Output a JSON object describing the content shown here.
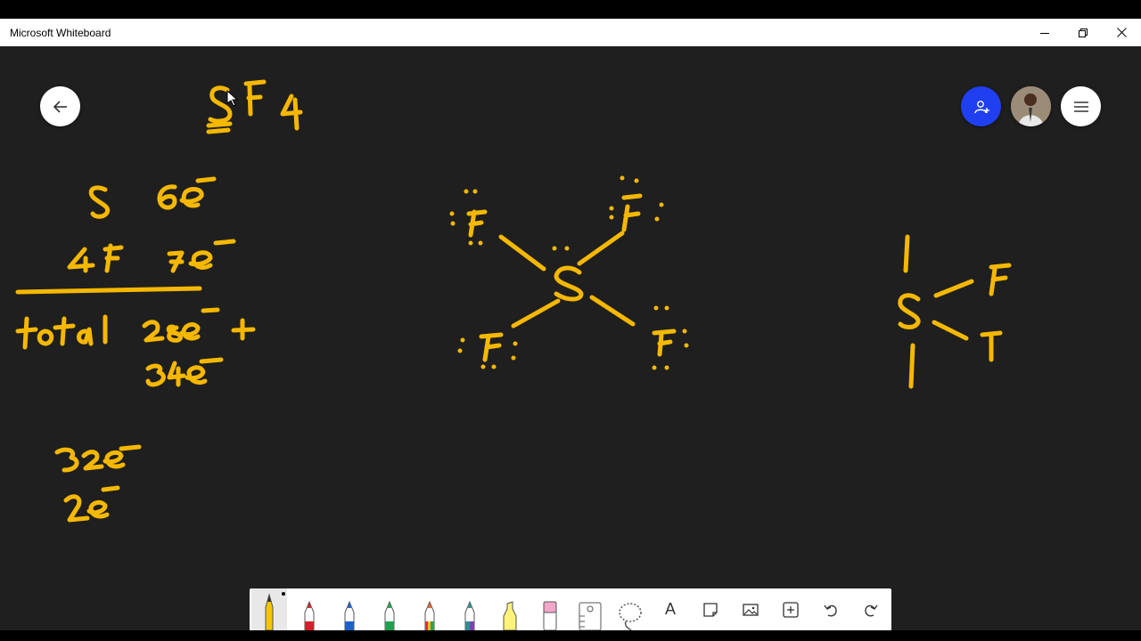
{
  "window": {
    "title": "Microsoft Whiteboard",
    "controls": [
      "minimize",
      "restore",
      "close"
    ]
  },
  "board": {
    "ink_color": "#f5b800",
    "background": "#1f1f1f",
    "handwriting": {
      "heading": "SF4",
      "lines": [
        "S 6e⁻",
        "4F 7e⁻",
        "total 28e⁻ +",
        "34e⁻",
        "32e⁻",
        "2e⁻"
      ],
      "structure_center": "S",
      "structure_ligands": [
        "F",
        "F",
        "F",
        "F"
      ],
      "seesaw_labels": [
        "S",
        "F",
        "F"
      ]
    }
  },
  "top_buttons": {
    "back": "arrow-left-icon",
    "invite": "person-add-icon",
    "avatar": "user-avatar",
    "menu": "hamburger-menu-icon"
  },
  "toolbar": {
    "tools": [
      {
        "name": "pen-yellow",
        "color": "#f5b800",
        "selected": true
      },
      {
        "name": "pen-red",
        "color": "#d0202a"
      },
      {
        "name": "pen-blue",
        "color": "#1f5fc8"
      },
      {
        "name": "pen-green",
        "color": "#1fa050"
      },
      {
        "name": "pen-rainbow",
        "color": "#e0602a"
      },
      {
        "name": "pen-galaxy",
        "color": "#2a9090"
      },
      {
        "name": "highlighter-yellow",
        "color": "#fff27a"
      },
      {
        "name": "eraser",
        "color": "#f2a6c8"
      },
      {
        "name": "ruler-icon"
      },
      {
        "name": "lasso-icon"
      },
      {
        "name": "text-icon",
        "glyph": "A"
      },
      {
        "name": "note-icon"
      },
      {
        "name": "image-icon"
      },
      {
        "name": "add-icon"
      },
      {
        "name": "undo-icon"
      },
      {
        "name": "redo-icon"
      }
    ]
  }
}
